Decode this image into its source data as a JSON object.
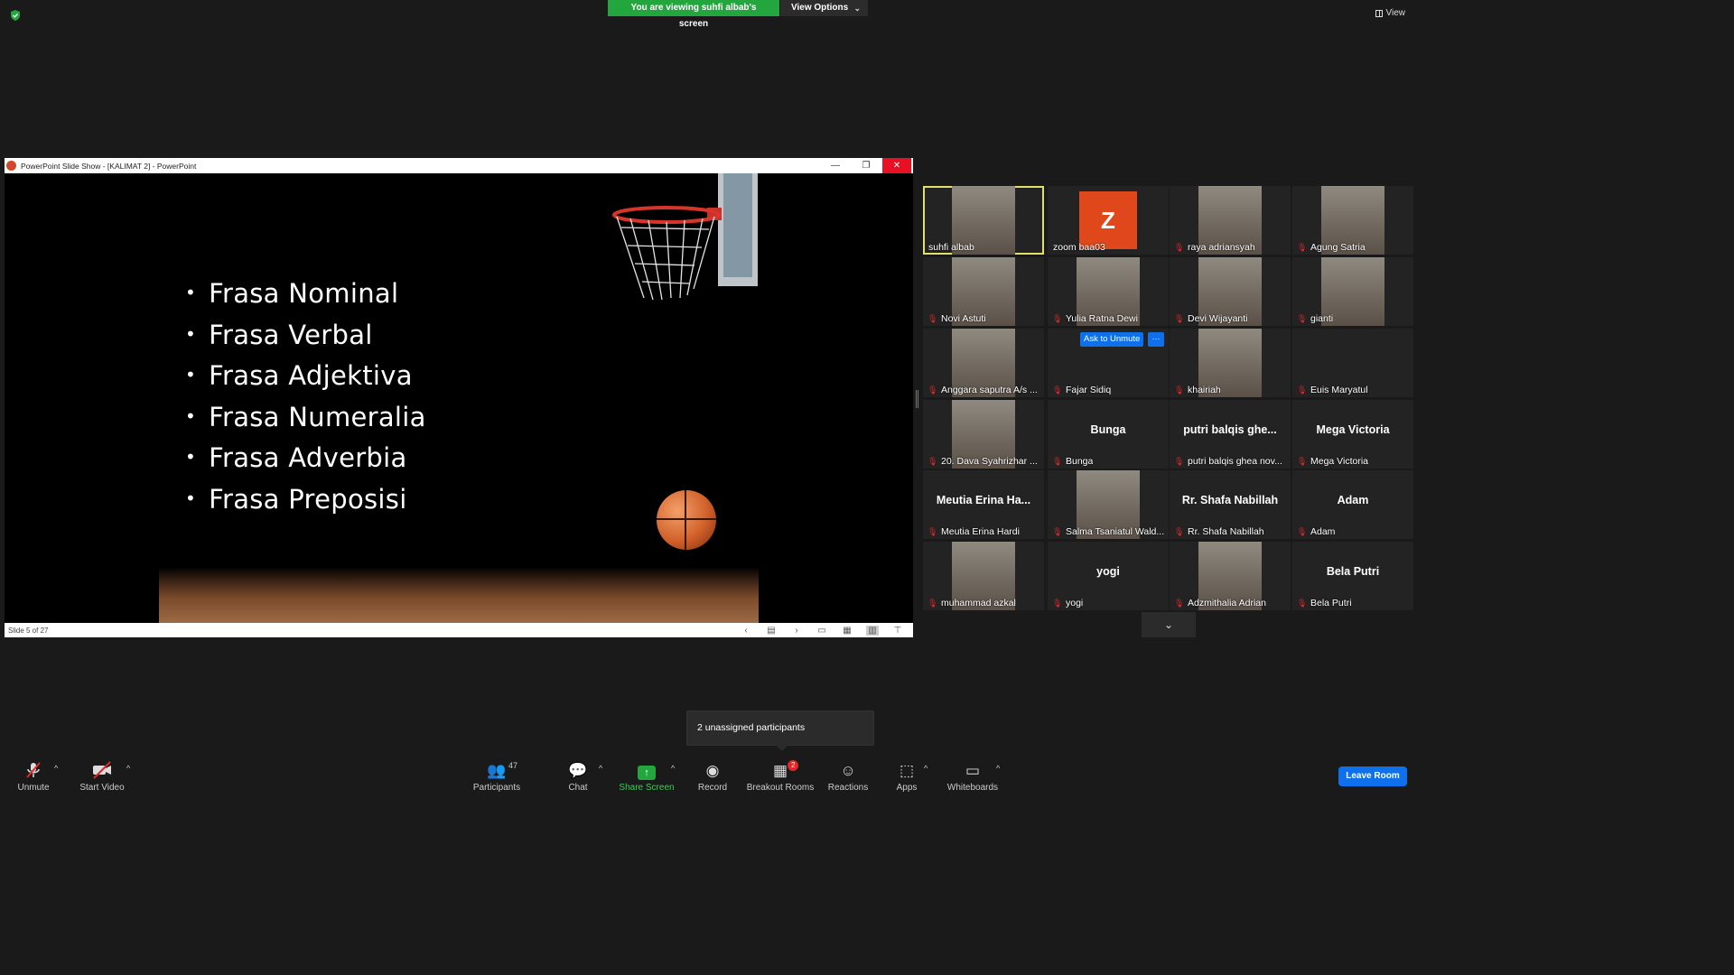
{
  "banner": {
    "viewing_text": "You are viewing suhfi albab's screen",
    "view_options": "View Options"
  },
  "top_right": {
    "view_label": "View"
  },
  "ppt": {
    "window_title": "PowerPoint Slide Show - [KALIMAT 2] - PowerPoint",
    "status": "Slide 5 of 27",
    "bullets": [
      "Frasa Nominal",
      "Frasa Verbal",
      "Frasa Adjektiva",
      "Frasa Numeralia",
      "Frasa Adverbia",
      "Frasa Preposisi"
    ]
  },
  "gallery": {
    "tiles": [
      {
        "name": "suhfi albab",
        "muted": false,
        "mode": "video",
        "active": true
      },
      {
        "name": "zoom baa03",
        "muted": false,
        "mode": "initial",
        "initial": "Z"
      },
      {
        "name": "raya adriansyah",
        "muted": true,
        "mode": "video"
      },
      {
        "name": "Agung Satria",
        "muted": true,
        "mode": "video"
      },
      {
        "name": "Novi Astuti",
        "muted": true,
        "mode": "video"
      },
      {
        "name": "Yulia Ratna Dewi",
        "muted": true,
        "mode": "video"
      },
      {
        "name": "Devi Wijayanti",
        "muted": true,
        "mode": "video"
      },
      {
        "name": "gianti",
        "muted": true,
        "mode": "video"
      },
      {
        "name": "Anggara saputra A/s ...",
        "muted": true,
        "mode": "video"
      },
      {
        "name": "Fajar Sidiq",
        "muted": true,
        "mode": "blank"
      },
      {
        "name": "khairiah",
        "muted": true,
        "mode": "video"
      },
      {
        "name": "Euis Maryatul",
        "muted": true,
        "mode": "blank"
      },
      {
        "name": "20. Dava Syahrizhar ...",
        "muted": true,
        "mode": "video"
      },
      {
        "name": "Bunga",
        "muted": true,
        "mode": "name",
        "big": "Bunga"
      },
      {
        "name": "putri balqis ghea nov...",
        "muted": true,
        "mode": "name",
        "big": "putri balqis ghe..."
      },
      {
        "name": "Mega Victoria",
        "muted": true,
        "mode": "name",
        "big": "Mega Victoria"
      },
      {
        "name": "Meutia Erina Hardi",
        "muted": true,
        "mode": "name",
        "big": "Meutia Erina Ha..."
      },
      {
        "name": "Salma Tsaniatul Wald...",
        "muted": true,
        "mode": "video"
      },
      {
        "name": "Rr. Shafa Nabillah",
        "muted": true,
        "mode": "name",
        "big": "Rr. Shafa Nabillah"
      },
      {
        "name": "Adam",
        "muted": true,
        "mode": "name",
        "big": "Adam"
      },
      {
        "name": "muhammad azkal",
        "muted": true,
        "mode": "video"
      },
      {
        "name": "yogi",
        "muted": true,
        "mode": "name",
        "big": "yogi"
      },
      {
        "name": "Adzmithalia Adrian",
        "muted": true,
        "mode": "video"
      },
      {
        "name": "Bela Putri",
        "muted": true,
        "mode": "name",
        "big": "Bela Putri"
      }
    ],
    "ask_unmute": "Ask to Unmute",
    "more": "···"
  },
  "tooltip": "2 unassigned participants",
  "toolbar": {
    "unmute": "Unmute",
    "start_video": "Start Video",
    "participants": "Participants",
    "participants_count": "47",
    "chat": "Chat",
    "share_screen": "Share Screen",
    "record": "Record",
    "breakout_rooms": "Breakout Rooms",
    "breakout_badge": "2",
    "reactions": "Reactions",
    "apps": "Apps",
    "whiteboards": "Whiteboards",
    "leave_room": "Leave Room"
  },
  "colors": {
    "share_green": "#23a63e",
    "leave_blue": "#0e71eb",
    "mute_red": "#e02828",
    "active_outline": "#e0e06a"
  }
}
